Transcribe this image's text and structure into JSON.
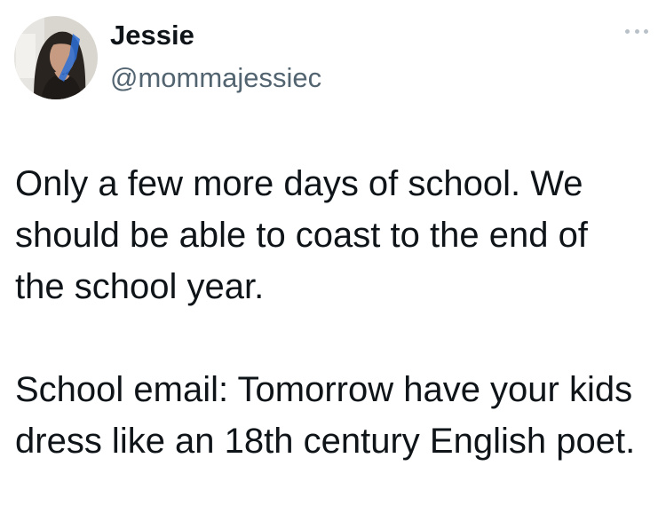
{
  "tweet": {
    "author": {
      "display_name": "Jessie",
      "handle": "@mommajessiec",
      "avatar_icon": "profile-photo-avatar"
    },
    "more_icon": "more-options-icon",
    "paragraphs": [
      "Only a few more days of school. We should be able to coast to the end of the school year.",
      "School email: Tomorrow have your kids dress like an 18th century English poet."
    ]
  }
}
